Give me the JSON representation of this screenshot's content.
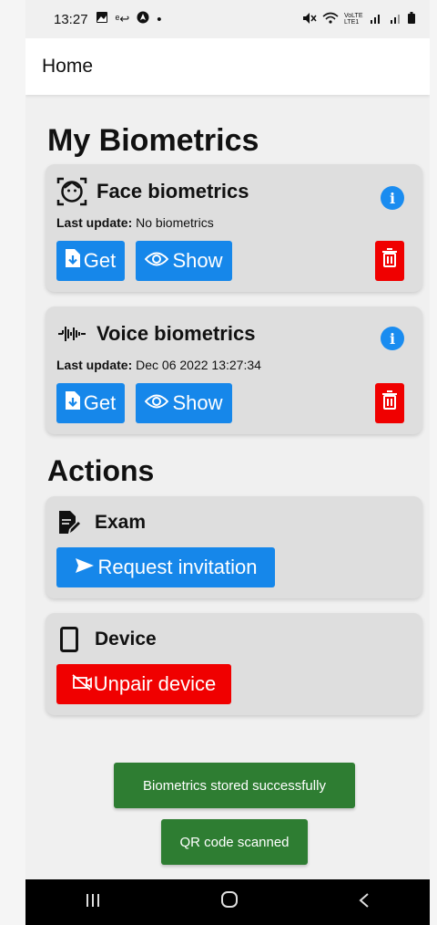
{
  "status_bar": {
    "time": "13:27",
    "left_icons": [
      "image-icon",
      "wifi-call-icon",
      "nav-icon",
      "dot-icon"
    ],
    "right_text": "VoLTE LTE1"
  },
  "app_bar": {
    "title": "Home"
  },
  "biometrics": {
    "heading": "My Biometrics",
    "cards": [
      {
        "title": "Face biometrics",
        "icon": "face-icon",
        "last_update_label": "Last update:",
        "last_update_value": "No biometrics",
        "get_label": "Get",
        "show_label": "Show"
      },
      {
        "title": "Voice biometrics",
        "icon": "waveform-icon",
        "last_update_label": "Last update:",
        "last_update_value": "Dec 06 2022 13:27:34",
        "get_label": "Get",
        "show_label": "Show"
      }
    ]
  },
  "actions": {
    "heading": "Actions",
    "exam": {
      "title": "Exam",
      "button_label": "Request invitation"
    },
    "device": {
      "title": "Device",
      "button_label": "Unpair device"
    }
  },
  "toasts": [
    {
      "text": "Biometrics stored successfully"
    },
    {
      "text": "QR code scanned"
    }
  ],
  "colors": {
    "primary": "#1687ea",
    "danger": "#f00000",
    "success": "#2e7d32",
    "info": "#1a8cf0"
  }
}
